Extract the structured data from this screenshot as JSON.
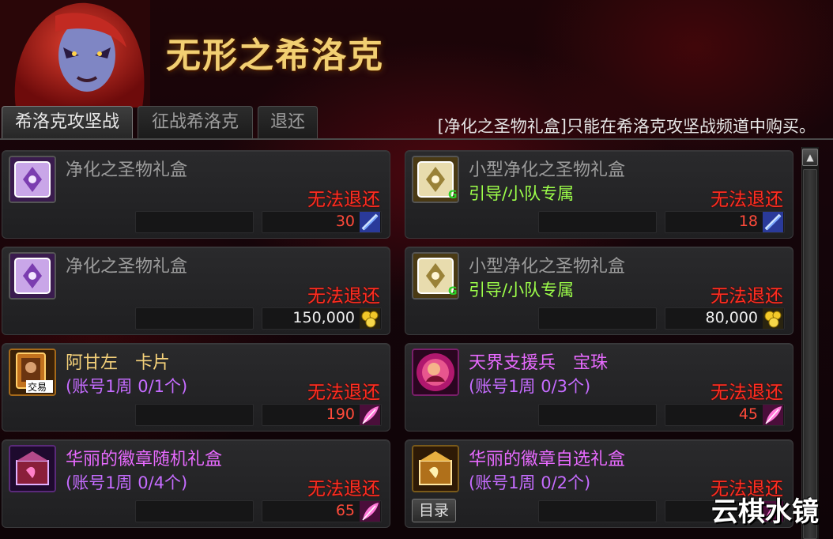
{
  "header": {
    "title": "无形之希洛克"
  },
  "tabs": [
    {
      "label": "希洛克攻坚战",
      "active": true
    },
    {
      "label": "征战希洛克",
      "active": false
    },
    {
      "label": "退还",
      "active": false
    }
  ],
  "notice": "[净化之圣物礼盒]只能在希洛克攻坚战频道中购买。",
  "items": [
    {
      "name": "净化之圣物礼盒",
      "sub": "",
      "refund": "无法退还",
      "price": "30",
      "price_color": "red",
      "currency_icon": "crystal-icon",
      "item_icon": "holy-box-purple-icon"
    },
    {
      "name": "小型净化之圣物礼盒",
      "sub": "引导/小队专属",
      "refund": "无法退还",
      "price": "18",
      "price_color": "red",
      "currency_icon": "crystal-icon",
      "item_icon": "holy-box-gold-icon"
    },
    {
      "name": "净化之圣物礼盒",
      "sub": "",
      "refund": "无法退还",
      "price": "150,000",
      "price_color": "white",
      "currency_icon": "gold-coin-icon",
      "item_icon": "holy-box-purple-icon"
    },
    {
      "name": "小型净化之圣物礼盒",
      "sub": "引导/小队专属",
      "refund": "无法退还",
      "price": "80,000",
      "price_color": "white",
      "currency_icon": "gold-coin-icon",
      "item_icon": "holy-box-gold-icon"
    },
    {
      "name": "阿甘左　卡片",
      "sub": "(账号1周 0/1个)",
      "refund": "无法退还",
      "price": "190",
      "price_color": "red",
      "currency_icon": "feather-icon",
      "item_icon": "card-icon",
      "icon_badge": "交易"
    },
    {
      "name": "天界支援兵　宝珠",
      "sub": "(账号1周 0/3个)",
      "refund": "无法退还",
      "price": "45",
      "price_color": "red",
      "currency_icon": "feather-icon",
      "item_icon": "orb-icon"
    },
    {
      "name": "华丽的徽章随机礼盒",
      "sub": "(账号1周 0/4个)",
      "refund": "无法退还",
      "price": "65",
      "price_color": "red",
      "currency_icon": "feather-icon",
      "item_icon": "emblem-box-random-icon"
    },
    {
      "name": "华丽的徽章自选礼盒",
      "sub": "(账号1周 0/2个)",
      "refund": "无法退还",
      "price": "",
      "price_color": "red",
      "currency_icon": "feather-icon",
      "item_icon": "emblem-box-select-icon",
      "button": "目录"
    }
  ],
  "watermark": "云棋水镜",
  "colors": {
    "title": "#f2cf72",
    "refund": "#ff2d20",
    "green": "#9dff4a",
    "purple": "#c56cff"
  }
}
